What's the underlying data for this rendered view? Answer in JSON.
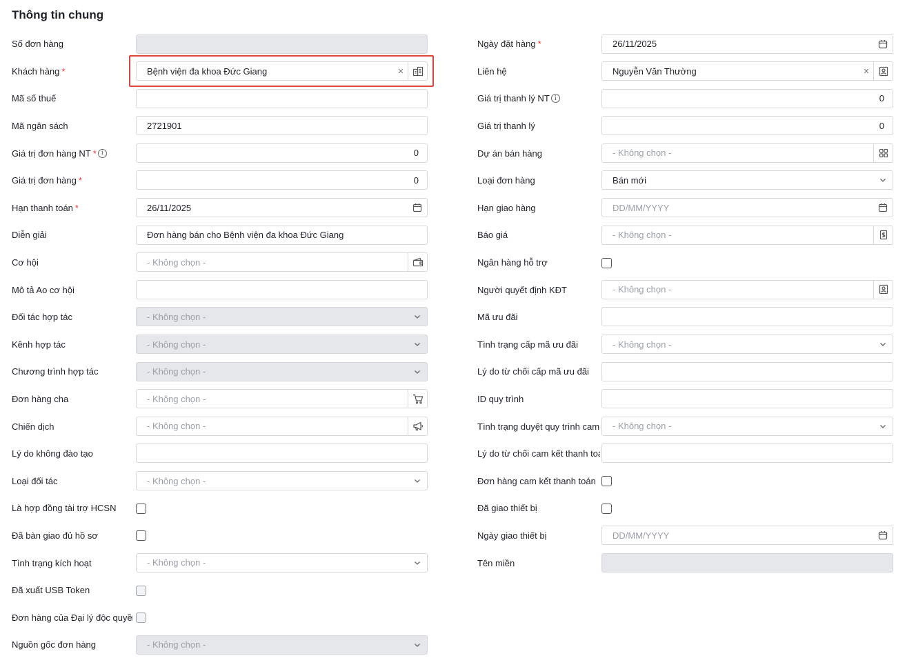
{
  "section_title": "Thông tin chung",
  "placeholder_none": "- Không chọn -",
  "left": [
    {
      "label": "Số đơn hàng",
      "required": false,
      "info": false,
      "type": "text",
      "disabled": true,
      "value": ""
    },
    {
      "label": "Khách hàng",
      "required": true,
      "info": false,
      "type": "lookup",
      "value": "Bệnh viện đa khoa Đức Giang",
      "clearable": true,
      "icon": "building-icon",
      "highlighted": true
    },
    {
      "label": "Mã số thuế",
      "required": false,
      "info": false,
      "type": "text",
      "value": ""
    },
    {
      "label": "Mã ngân sách",
      "required": false,
      "info": false,
      "type": "text",
      "value": "2721901"
    },
    {
      "label": "Giá trị đơn hàng NT",
      "required": true,
      "info": true,
      "type": "number",
      "value": "0"
    },
    {
      "label": "Giá trị đơn hàng",
      "required": true,
      "info": false,
      "type": "number",
      "value": "0"
    },
    {
      "label": "Hạn thanh toán",
      "required": true,
      "info": false,
      "type": "date",
      "value": "26/11/2025",
      "icon": "calendar-icon"
    },
    {
      "label": "Diễn giải",
      "required": false,
      "info": false,
      "type": "text",
      "value": "Đơn hàng bán cho Bệnh viện đa khoa Đức Giang"
    },
    {
      "label": "Cơ hội",
      "required": false,
      "info": false,
      "type": "lookup",
      "placeholder": "- Không chọn -",
      "icon": "wallet-icon"
    },
    {
      "label": "Mô tả Ao cơ hội",
      "required": false,
      "info": false,
      "type": "text",
      "value": ""
    },
    {
      "label": "Đối tác hợp tác",
      "required": false,
      "info": false,
      "type": "select",
      "disabled": true,
      "placeholder": "- Không chọn -",
      "icon": "chevron-down-icon"
    },
    {
      "label": "Kênh hợp tác",
      "required": false,
      "info": false,
      "type": "select",
      "disabled": true,
      "placeholder": "- Không chọn -",
      "icon": "chevron-down-icon"
    },
    {
      "label": "Chương trình hợp tác",
      "required": false,
      "info": false,
      "type": "select",
      "disabled": true,
      "placeholder": "- Không chọn -",
      "icon": "chevron-down-icon"
    },
    {
      "label": "Đơn hàng cha",
      "required": false,
      "info": false,
      "type": "lookup",
      "placeholder": "- Không chọn -",
      "icon": "cart-icon"
    },
    {
      "label": "Chiến dịch",
      "required": false,
      "info": false,
      "type": "lookup",
      "placeholder": "- Không chọn -",
      "icon": "megaphone-icon"
    },
    {
      "label": "Lý do không đào tạo",
      "required": false,
      "info": false,
      "type": "text",
      "value": ""
    },
    {
      "label": "Loại đối tác",
      "required": false,
      "info": false,
      "type": "select",
      "placeholder": "- Không chọn -",
      "icon": "chevron-down-icon"
    },
    {
      "label": "Là hợp đồng tài trợ HCSN",
      "required": false,
      "info": false,
      "type": "checkbox",
      "checked": false
    },
    {
      "label": "Đã bàn giao đủ hồ sơ",
      "required": false,
      "info": false,
      "type": "checkbox",
      "checked": false
    },
    {
      "label": "Tình trạng kích hoạt",
      "required": false,
      "info": false,
      "type": "select",
      "placeholder": "- Không chọn -",
      "icon": "chevron-down-icon"
    },
    {
      "label": "Đã xuất USB Token",
      "required": false,
      "info": false,
      "type": "checkbox",
      "checked": false,
      "disabled": true
    },
    {
      "label": "Đơn hàng của Đại lý độc quyền",
      "required": false,
      "info": false,
      "type": "checkbox",
      "checked": false,
      "disabled": true
    },
    {
      "label": "Nguồn gốc đơn hàng",
      "required": false,
      "info": false,
      "type": "select",
      "disabled": true,
      "placeholder": "- Không chọn -",
      "icon": "chevron-down-icon"
    }
  ],
  "right": [
    {
      "label": "Ngày đặt hàng",
      "required": true,
      "info": false,
      "type": "date",
      "value": "26/11/2025",
      "icon": "calendar-icon"
    },
    {
      "label": "Liên hệ",
      "required": false,
      "info": false,
      "type": "lookup",
      "value": "Nguyễn Văn Thường",
      "clearable": true,
      "icon": "contact-icon"
    },
    {
      "label": "Giá trị thanh lý NT",
      "required": false,
      "info": true,
      "type": "number",
      "value": "0"
    },
    {
      "label": "Giá trị thanh lý",
      "required": false,
      "info": false,
      "type": "number",
      "value": "0"
    },
    {
      "label": "Dự án bán hàng",
      "required": false,
      "info": false,
      "type": "lookup",
      "placeholder": "- Không chọn -",
      "icon": "grid-icon"
    },
    {
      "label": "Loại đơn hàng",
      "required": false,
      "info": false,
      "type": "select",
      "value": "Bán mới",
      "icon": "chevron-down-icon"
    },
    {
      "label": "Hạn giao hàng",
      "required": false,
      "info": false,
      "type": "date",
      "placeholder": "DD/MM/YYYY",
      "icon": "calendar-icon"
    },
    {
      "label": "Báo giá",
      "required": false,
      "info": false,
      "type": "lookup",
      "placeholder": "- Không chọn -",
      "icon": "quote-icon"
    },
    {
      "label": "Ngân hàng hỗ trợ",
      "required": false,
      "info": false,
      "type": "checkbox",
      "checked": false
    },
    {
      "label": "Người quyết định KĐT",
      "required": false,
      "info": false,
      "type": "lookup",
      "placeholder": "- Không chọn -",
      "icon": "contact-icon"
    },
    {
      "label": "Mã ưu đãi",
      "required": false,
      "info": false,
      "type": "text",
      "value": ""
    },
    {
      "label": "Tình trạng cấp mã ưu đãi",
      "required": false,
      "info": false,
      "type": "select",
      "placeholder": "- Không chọn -",
      "icon": "chevron-down-icon"
    },
    {
      "label": "Lý do từ chối cấp mã ưu đãi",
      "required": false,
      "info": false,
      "type": "text",
      "value": ""
    },
    {
      "label": "ID quy trình",
      "required": false,
      "info": false,
      "type": "text",
      "value": ""
    },
    {
      "label": "Tình trạng duyệt quy trình cam ...",
      "required": false,
      "info": false,
      "type": "select",
      "placeholder": "- Không chọn -",
      "icon": "chevron-down-icon"
    },
    {
      "label": "Lý do từ chối cam kết thanh toán",
      "required": false,
      "info": false,
      "type": "text",
      "value": ""
    },
    {
      "label": "Đơn hàng cam kết thanh toán",
      "required": false,
      "info": false,
      "type": "checkbox",
      "checked": false
    },
    {
      "label": "Đã giao thiết bị",
      "required": false,
      "info": false,
      "type": "checkbox",
      "checked": false
    },
    {
      "label": "Ngày giao thiết bị",
      "required": false,
      "info": false,
      "type": "date",
      "placeholder": "DD/MM/YYYY",
      "icon": "calendar-icon"
    },
    {
      "label": "Tên miền",
      "required": false,
      "info": false,
      "type": "text",
      "disabled": true,
      "value": ""
    }
  ],
  "colors": {
    "required": "#e53935",
    "highlight": "#e0453a",
    "disabled_bg": "#e5e7eb",
    "border": "#d4d7dc"
  }
}
